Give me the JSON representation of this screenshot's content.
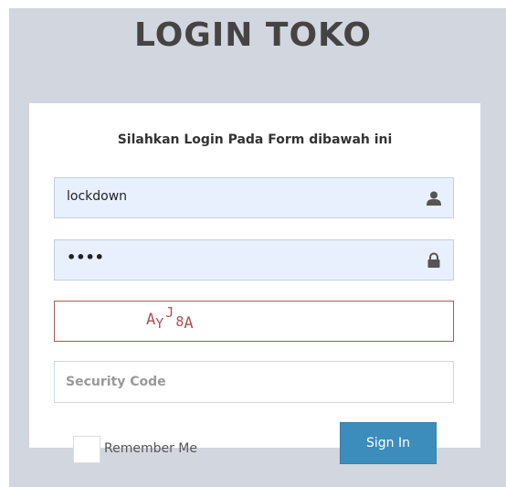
{
  "page": {
    "title": "LOGIN TOKO"
  },
  "login_box": {
    "message": "Silahkan Login Pada Form dibawah ini",
    "username": {
      "value": "lockdown",
      "icon": "user-icon"
    },
    "password": {
      "value": "••••",
      "icon": "lock-icon"
    },
    "captcha": {
      "chars": [
        "A",
        "Y",
        "J",
        "8",
        "A"
      ]
    },
    "security_code": {
      "placeholder": "Security Code",
      "value": ""
    },
    "remember_me": {
      "label": "Remember Me",
      "checked": false
    },
    "sign_in_label": "Sign In"
  },
  "colors": {
    "background": "#d2d6de",
    "autofill": "#e8f0fe",
    "primary": "#3c8dbc",
    "captcha_text": "#b05050"
  }
}
